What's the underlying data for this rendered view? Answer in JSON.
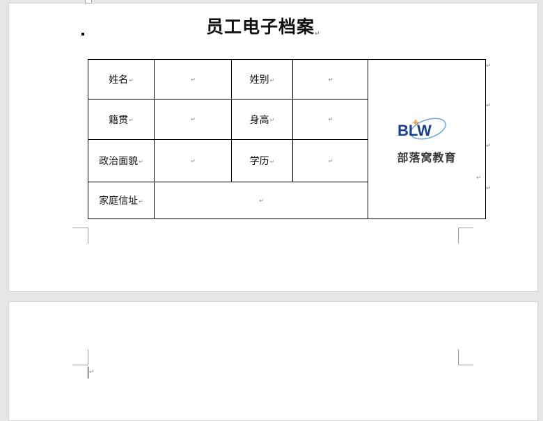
{
  "document": {
    "title": "员工电子档案",
    "paragraph_mark": "↵"
  },
  "table": {
    "name_label": "姓名",
    "gender_label": "姓别",
    "native_place_label": "籍贯",
    "height_label": "身高",
    "political_status_label": "政治面貌",
    "education_label": "学历",
    "address_label": "家庭信址"
  },
  "logo": {
    "text": "部落窝教育",
    "brand_color": "#1a3f8f",
    "accent_color": "#e8a64a"
  },
  "colors": {
    "background": "#e6e6e6",
    "page": "#ffffff",
    "border": "#000000"
  }
}
